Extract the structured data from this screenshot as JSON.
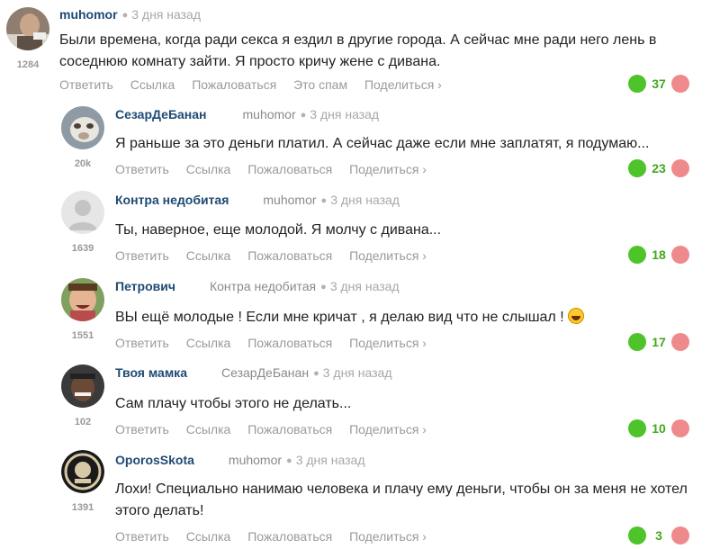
{
  "actions": {
    "reply": "Ответить",
    "link": "Ссылка",
    "report": "Пожаловаться",
    "spam": "Это спам",
    "share": "Поделиться"
  },
  "comments": [
    {
      "author": "muhomor",
      "reply_to": "",
      "time": "3 дня назад",
      "rating": "1284",
      "text": "Были времена, когда ради секса я ездил в другие города. А сейчас мне ради него лень в соседнюю комнату зайти. Я просто кричу жене с дивана.",
      "score": "37"
    },
    {
      "author": "СезарДеБанан",
      "reply_to": "muhomor",
      "time": "3 дня назад",
      "rating": "20k",
      "text": "Я раньше за это деньги платил. А сейчас даже если мне заплатят, я подумаю...",
      "score": "23"
    },
    {
      "author": "Контра недобитая",
      "reply_to": "muhomor",
      "time": "3 дня назад",
      "rating": "1639",
      "text": "Ты, наверное, еще молодой. Я молчу с дивана...",
      "score": "18"
    },
    {
      "author": "Петрович",
      "reply_to": "Контра недобитая",
      "time": "3 дня назад",
      "rating": "1551",
      "text": "ВЫ ещё молодые ! Если мне кричат , я делаю вид что не слышал !",
      "score": "17"
    },
    {
      "author": "Твоя мамка",
      "reply_to": "СезарДеБанан",
      "time": "3 дня назад",
      "rating": "102",
      "text": "Сам плачу чтобы этого не делать...",
      "score": "10"
    },
    {
      "author": "OporosSkota",
      "reply_to": "muhomor",
      "time": "3 дня назад",
      "rating": "1391",
      "text": "Лохи! Специально нанимаю человека и плачу ему деньги, чтобы он за меня не хотел этого делать!",
      "score": "3"
    }
  ]
}
